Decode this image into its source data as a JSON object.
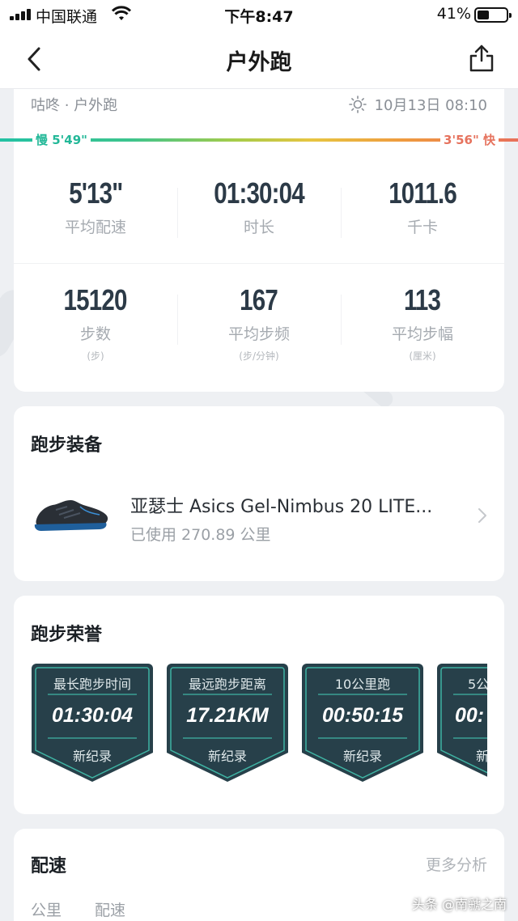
{
  "status_bar": {
    "carrier": "中国联通",
    "time": "下午8:47",
    "battery_pct": "41%",
    "battery_level": 0.41
  },
  "nav": {
    "title": "户外跑"
  },
  "summary": {
    "source": "咕咚 · 户外跑",
    "datetime": "10月13日 08:10",
    "pace_slow": "慢 5'49\"",
    "pace_fast": "3'56\" 快",
    "stats_row1": [
      {
        "value": "5'13\"",
        "label": "平均配速"
      },
      {
        "value": "01:30:04",
        "label": "时长"
      },
      {
        "value": "1011.6",
        "label": "千卡"
      }
    ],
    "stats_row2": [
      {
        "value": "15120",
        "label": "步数",
        "unit": "(步)"
      },
      {
        "value": "167",
        "label": "平均步频",
        "unit": "(步/分钟)"
      },
      {
        "value": "113",
        "label": "平均步幅",
        "unit": "(厘米)"
      }
    ]
  },
  "equipment": {
    "title": "跑步装备",
    "shoe_name": "亚瑟士 Asics Gel-Nimbus 20 LITE...",
    "used": "已使用 270.89 公里"
  },
  "honors": {
    "title": "跑步荣誉",
    "badges": [
      {
        "title": "最长跑步时间",
        "value": "01:30:04",
        "sub": "新纪录"
      },
      {
        "title": "最远跑步距离",
        "value": "17.21KM",
        "sub": "新纪录"
      },
      {
        "title": "10公里跑",
        "value": "00:50:15",
        "sub": "新纪录"
      },
      {
        "title": "5公",
        "value": "00:",
        "sub": "新"
      }
    ]
  },
  "pace_section": {
    "title": "配速",
    "more": "更多分析",
    "col_km": "公里",
    "col_pace": "配速"
  },
  "watermark": "头条 @南虢之南",
  "colors": {
    "pace_slow": "#23b898",
    "pace_fast": "#e6735e",
    "badge_bg": "#27404a",
    "badge_border": "#3fb3a3"
  }
}
